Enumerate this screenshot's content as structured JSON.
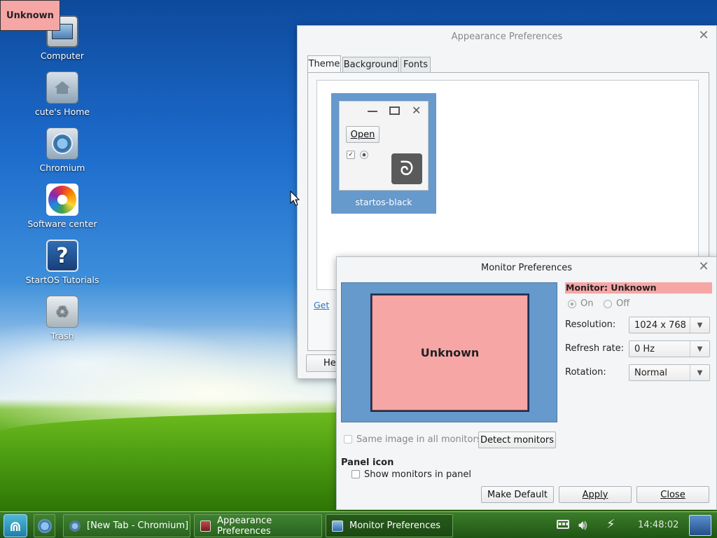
{
  "badge": "Unknown",
  "desktop_icons": [
    {
      "label": "Computer",
      "icon": "computer-icon"
    },
    {
      "label": "cute's Home",
      "icon": "home-folder-icon"
    },
    {
      "label": "Chromium",
      "icon": "chromium-icon"
    },
    {
      "label": "Software center",
      "icon": "software-center-icon"
    },
    {
      "label": "StartOS Tutorials",
      "icon": "help-icon"
    },
    {
      "label": "Trash",
      "icon": "trash-icon"
    }
  ],
  "appearance": {
    "title": "Appearance Preferences",
    "tabs": [
      "Theme",
      "Background",
      "Fonts"
    ],
    "theme_name": "startos-black",
    "preview_button": "Open",
    "get_link": "Get",
    "help_button": "He"
  },
  "monitor": {
    "title": "Monitor Preferences",
    "screen_label": "Unknown",
    "monitor_heading": "Monitor: Unknown",
    "on_label": "On",
    "off_label": "Off",
    "resolution_label": "Resolution:",
    "resolution_value": "1024 x 768",
    "refresh_label": "Refresh rate:",
    "refresh_value": "0 Hz",
    "rotation_label": "Rotation:",
    "rotation_value": "Normal",
    "same_image_label": "Same image in all monitors",
    "detect_button": "Detect monitors",
    "panel_icon_heading": "Panel icon",
    "show_monitors_label": "Show monitors in panel",
    "make_default_button": "Make Default",
    "apply_button": "Apply",
    "close_button": "Close",
    "highlight_color": "#f7a6a6",
    "screen_color": "#f7a6a6",
    "preview_bg_color": "#6699cc"
  },
  "taskbar": {
    "tasks": [
      {
        "label": "[New Tab - Chromium]",
        "icon": "chromium-icon"
      },
      {
        "label": "Appearance Preferences",
        "icon": "appearance-icon"
      },
      {
        "label": "Monitor Preferences",
        "icon": "monitor-icon"
      }
    ],
    "clock": "14:48:02"
  }
}
